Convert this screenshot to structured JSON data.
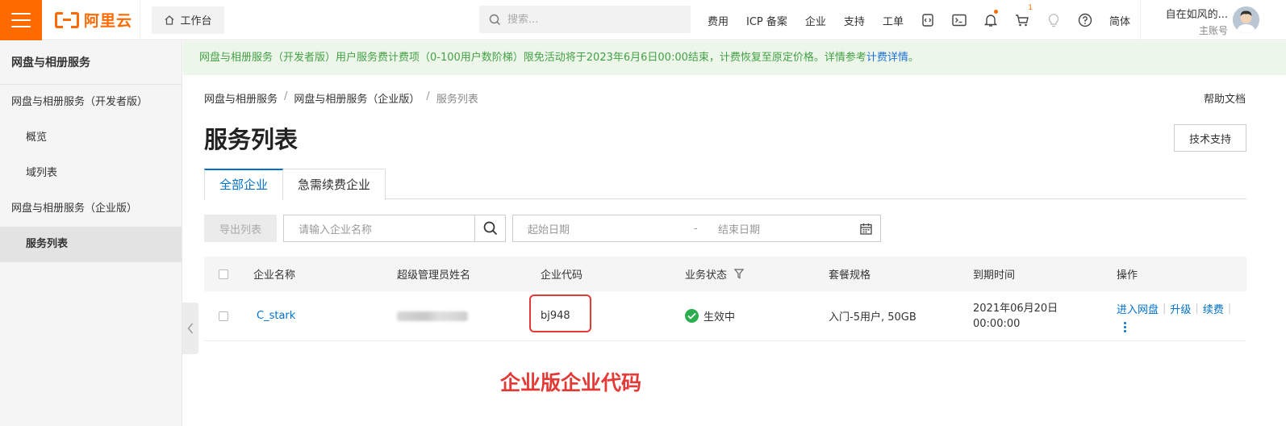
{
  "topbar": {
    "logo_text": "阿里云",
    "workbench": "工作台",
    "search_placeholder": "搜索...",
    "nav_links": [
      "费用",
      "ICP 备案",
      "企业",
      "支持",
      "工单"
    ],
    "cart_count": "1",
    "lang": "简体",
    "account_name": "自在如风的...",
    "account_sub": "主账号"
  },
  "sidebar": {
    "title": "网盘与相册服务",
    "groups": [
      {
        "label": "网盘与相册服务（开发者版）",
        "items": [
          "概览",
          "域列表"
        ]
      },
      {
        "label": "网盘与相册服务（企业版）",
        "items": [
          "服务列表"
        ]
      }
    ]
  },
  "notice": {
    "text": "网盘与相册服务（开发者版）用户服务费计费项（0-100用户数阶梯）限免活动将于2023年6月6日00:00结束，计费恢复至原定价格。详情参考",
    "link": "计费详情",
    "suffix": "。"
  },
  "breadcrumb": [
    "网盘与相册服务",
    "网盘与相册服务（企业版）",
    "服务列表"
  ],
  "help_doc": "帮助文档",
  "page_title": "服务列表",
  "tech_support": "技术支持",
  "tabs": [
    "全部企业",
    "急需续费企业"
  ],
  "toolbar": {
    "export": "导出列表",
    "enterprise_placeholder": "请输入企业名称",
    "start_date": "起始日期",
    "dash": "-",
    "end_date": "结束日期"
  },
  "table": {
    "headers": [
      "企业名称",
      "超级管理员姓名",
      "企业代码",
      "业务状态",
      "套餐规格",
      "到期时间",
      "操作"
    ],
    "rows": [
      {
        "name": "C_stark",
        "code": "bj948",
        "status": "生效中",
        "plan": "入门-5用户, 50GB",
        "expire_date": "2021年06月20日",
        "expire_time": "00:00:00",
        "ops": [
          "进入网盘",
          "升级",
          "续费"
        ]
      }
    ]
  },
  "annotation": "企业版企业代码",
  "colors": {
    "brand": "#ff6a00",
    "link": "#0070cc",
    "notice_text": "#43a047",
    "annotation": "#e53935"
  }
}
